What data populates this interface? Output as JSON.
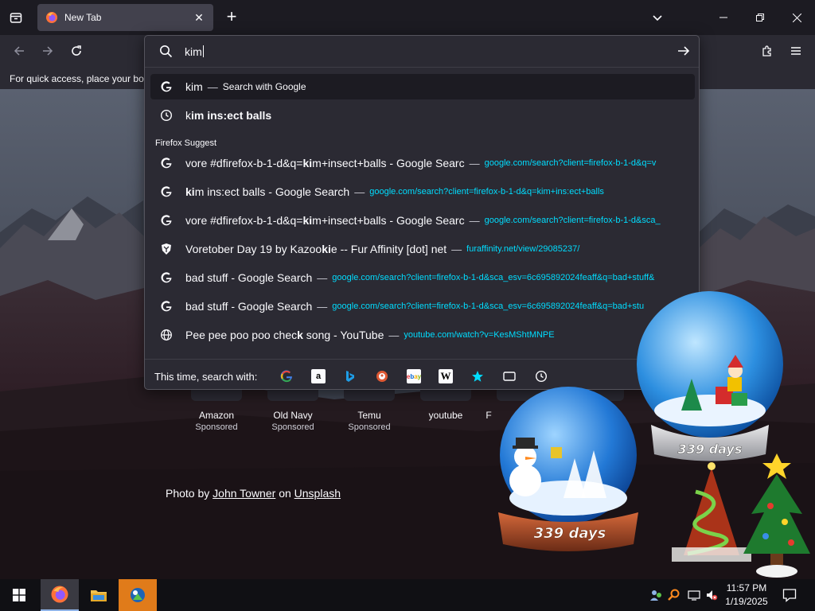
{
  "window": {
    "tab": {
      "title": "New Tab",
      "close": "✕"
    },
    "new_tab": "+"
  },
  "bookmarks_bar": {
    "hint": "For quick access, place your boo"
  },
  "urlbar": {
    "typed": "kim",
    "results": [
      {
        "kind": "search",
        "icon": "google-icon",
        "title": "kim",
        "sep": "—",
        "action": "Search with Google"
      },
      {
        "kind": "history",
        "icon": "history-clock-icon",
        "pre": "k",
        "bold": "im ins:ect balls",
        "post": ""
      }
    ],
    "group_label": "Firefox Suggest",
    "suggest": [
      {
        "icon": "google-icon",
        "pre": "vore #dfirefox-b-1-d&q=",
        "bold": "ki",
        "post": "m+insect+balls - Google Searc",
        "sep": "—",
        "url": "google.com/search?client=firefox-b-1-d&q=v"
      },
      {
        "icon": "google-icon",
        "pre": "",
        "bold": "ki",
        "post": "m ins:ect balls - Google Search",
        "sep": "—",
        "url": "google.com/search?client=firefox-b-1-d&q=kim+ins:ect+balls"
      },
      {
        "icon": "google-icon",
        "pre": "vore #dfirefox-b-1-d&q=",
        "bold": "ki",
        "post": "m+insect+balls - Google Searc",
        "sep": "—",
        "url": "google.com/search?client=firefox-b-1-d&sca_"
      },
      {
        "icon": "furaffinity-icon",
        "pre": "Voretober Day 19 by Kazoo",
        "bold": "ki",
        "post": "e -- Fur Affinity [dot] net",
        "sep": "—",
        "url": "furaffinity.net/view/29085237/"
      },
      {
        "icon": "google-icon",
        "pre": "bad stuff - Google Search",
        "bold": "",
        "post": "",
        "sep": "—",
        "url": "google.com/search?client=firefox-b-1-d&sca_esv=6c695892024feaff&q=bad+stuff&"
      },
      {
        "icon": "google-icon",
        "pre": "bad stuff - Google Search",
        "bold": "",
        "post": "",
        "sep": "—",
        "url": "google.com/search?client=firefox-b-1-d&sca_esv=6c695892024feaff&q=bad+stu"
      },
      {
        "icon": "globe-icon",
        "pre": "Pee pee poo poo chec",
        "bold": "k",
        "post": " song - YouTube",
        "sep": "—",
        "url": "youtube.com/watch?v=KesMShtMNPE"
      }
    ],
    "oneoff_label": "This time, search with:",
    "engines": [
      "google-engine-icon",
      "amazon-engine-icon",
      "bing-engine-icon",
      "duckduckgo-engine-icon",
      "ebay-engine-icon",
      "wikipedia-engine-icon",
      "bookmarks-star-icon",
      "tabs-icon",
      "history-icon"
    ]
  },
  "top_sites": [
    {
      "label": "Amazon",
      "sponsored": "Sponsored"
    },
    {
      "label": "Old Navy",
      "sponsored": "Sponsored"
    },
    {
      "label": "Temu",
      "sponsored": "Sponsored"
    },
    {
      "label": "youtube",
      "sponsored": ""
    },
    {
      "label": "F",
      "sponsored": ""
    }
  ],
  "photo_credit": {
    "prefix": "Photo by",
    "author": "John Towner",
    "mid": "on",
    "site": "Unsplash"
  },
  "widgets": {
    "days_left": "339 days"
  },
  "taskbar": {
    "time": "11:57 PM",
    "date": "1/19/2025"
  },
  "colors": {
    "accent_url": "#00ddff",
    "chrome": "#2b2a33",
    "tabstrip": "#1c1b22"
  }
}
